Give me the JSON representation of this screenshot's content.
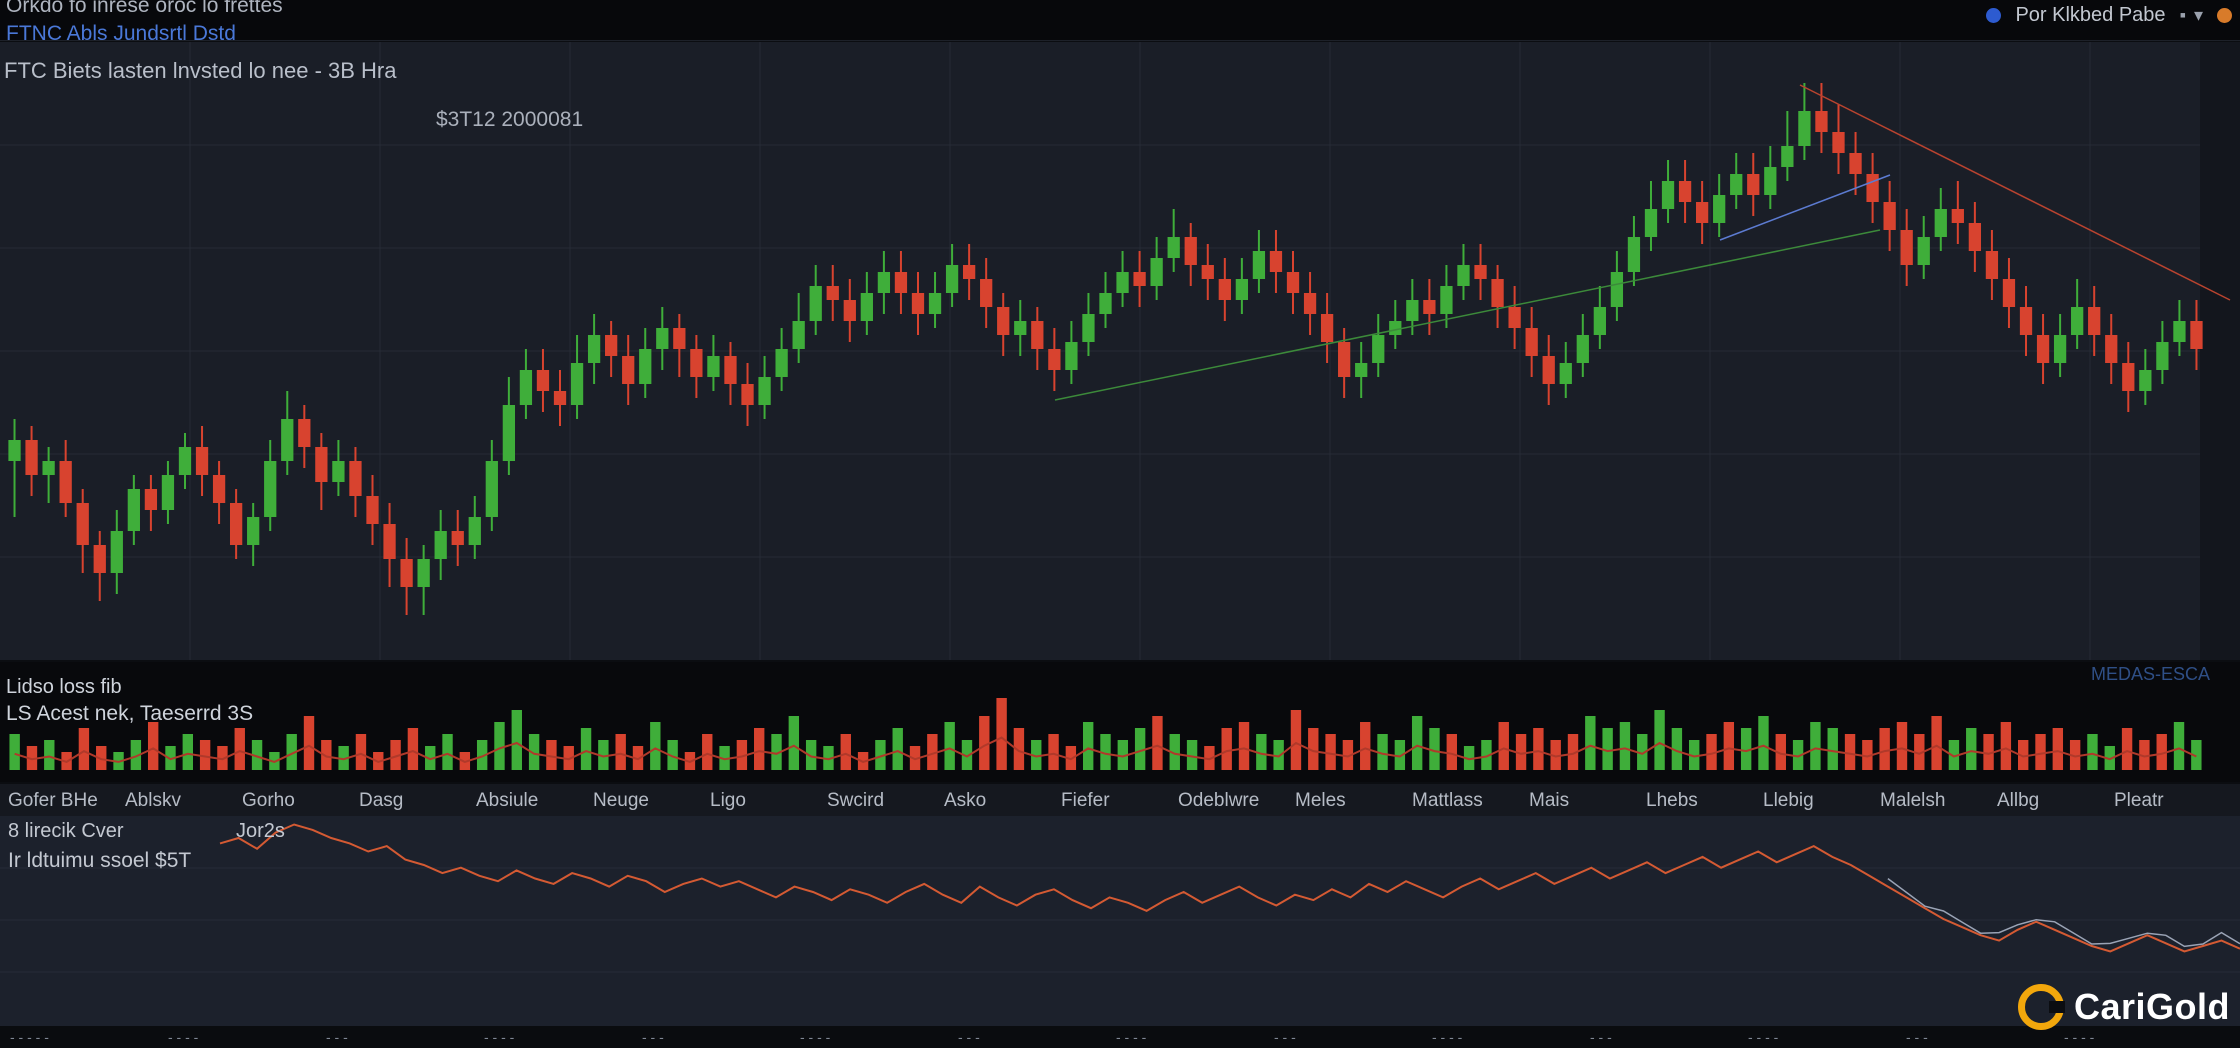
{
  "window": {
    "title": "Orkdo fo inrese oroc lo frettes",
    "subtitle": "FTNC Abls  Jundsrtl Dstd",
    "right_label": "Por Klkbed Pabe",
    "right_tools": [
      "▪",
      "▾"
    ]
  },
  "main_panel": {
    "pair_line": "FTC Biets lasten lnvsted lo nee - 3B Hra",
    "price_readout": "$3T12 2000081"
  },
  "volume_panel": {
    "title": "Lidso loss fib",
    "subtitle": "LS Acest nek, Taeserrd 3S",
    "right_label": "MEDAS-ESCA"
  },
  "x_axis_labels": [
    "Gofer BHe",
    "Ablskv",
    "Gorho",
    "Dasg",
    "Absiule",
    "Neuge",
    "Ligo",
    "Swcird",
    "Asko",
    "Fiefer",
    "Odeblwre",
    "Meles",
    "Mattlass",
    "Mais",
    "Lhebs",
    "Llebig",
    "Malelsh",
    "Allbg",
    "Pleatr"
  ],
  "oscillator_panel": {
    "title": "8 lirecik Cver",
    "subtitle": "Ir ldtuimu ssoel $5T",
    "value": "Jor2s"
  },
  "brand": {
    "name": "CariGold",
    "color": "#f2a70c"
  },
  "bottom_axis": [
    "- - - - -",
    "- - - -",
    "- - -",
    "- - - -",
    "- - -",
    "- - - -",
    "- - -",
    "- - - -",
    "- - -",
    "- - - -",
    "- - -",
    "- - - -",
    "- - -",
    "- - - -"
  ],
  "colors": {
    "up": "#3fae3a",
    "down": "#d8432f",
    "background": "#1b1f28",
    "grid": "#262b36",
    "osc_line": "#d45a33"
  },
  "chart_data": {
    "type": "candlestick",
    "title": "FTC Biets lasten lnvsted lo nee - 3B Hra",
    "candles": [
      [
        52,
        55,
        44,
        58
      ],
      [
        55,
        50,
        47,
        57
      ],
      [
        50,
        52,
        46,
        54
      ],
      [
        52,
        46,
        44,
        55
      ],
      [
        46,
        40,
        36,
        48
      ],
      [
        40,
        36,
        32,
        42
      ],
      [
        36,
        42,
        33,
        45
      ],
      [
        42,
        48,
        40,
        50
      ],
      [
        48,
        45,
        42,
        50
      ],
      [
        45,
        50,
        43,
        52
      ],
      [
        50,
        54,
        48,
        56
      ],
      [
        54,
        50,
        47,
        57
      ],
      [
        50,
        46,
        43,
        52
      ],
      [
        46,
        40,
        38,
        48
      ],
      [
        40,
        44,
        37,
        46
      ],
      [
        44,
        52,
        42,
        55
      ],
      [
        52,
        58,
        50,
        62
      ],
      [
        58,
        54,
        51,
        60
      ],
      [
        54,
        49,
        45,
        56
      ],
      [
        49,
        52,
        47,
        55
      ],
      [
        52,
        47,
        44,
        54
      ],
      [
        47,
        43,
        40,
        50
      ],
      [
        43,
        38,
        34,
        46
      ],
      [
        38,
        34,
        30,
        41
      ],
      [
        34,
        38,
        30,
        40
      ],
      [
        38,
        42,
        35,
        45
      ],
      [
        42,
        40,
        37,
        45
      ],
      [
        40,
        44,
        38,
        47
      ],
      [
        44,
        52,
        42,
        55
      ],
      [
        52,
        60,
        50,
        64
      ],
      [
        60,
        65,
        58,
        68
      ],
      [
        65,
        62,
        59,
        68
      ],
      [
        62,
        60,
        57,
        65
      ],
      [
        60,
        66,
        58,
        70
      ],
      [
        66,
        70,
        63,
        73
      ],
      [
        70,
        67,
        64,
        72
      ],
      [
        67,
        63,
        60,
        70
      ],
      [
        63,
        68,
        61,
        71
      ],
      [
        68,
        71,
        65,
        74
      ],
      [
        71,
        68,
        64,
        73
      ],
      [
        68,
        64,
        61,
        70
      ],
      [
        64,
        67,
        62,
        70
      ],
      [
        67,
        63,
        60,
        69
      ],
      [
        63,
        60,
        57,
        66
      ],
      [
        60,
        64,
        58,
        67
      ],
      [
        64,
        68,
        62,
        71
      ],
      [
        68,
        72,
        66,
        76
      ],
      [
        72,
        77,
        70,
        80
      ],
      [
        77,
        75,
        72,
        80
      ],
      [
        75,
        72,
        69,
        78
      ],
      [
        72,
        76,
        70,
        79
      ],
      [
        76,
        79,
        73,
        82
      ],
      [
        79,
        76,
        73,
        82
      ],
      [
        76,
        73,
        70,
        79
      ],
      [
        73,
        76,
        71,
        79
      ],
      [
        76,
        80,
        74,
        83
      ],
      [
        80,
        78,
        75,
        83
      ],
      [
        78,
        74,
        71,
        81
      ],
      [
        74,
        70,
        67,
        76
      ],
      [
        70,
        72,
        67,
        75
      ],
      [
        72,
        68,
        65,
        74
      ],
      [
        68,
        65,
        62,
        71
      ],
      [
        65,
        69,
        63,
        72
      ],
      [
        69,
        73,
        67,
        76
      ],
      [
        73,
        76,
        71,
        79
      ],
      [
        76,
        79,
        74,
        82
      ],
      [
        79,
        77,
        74,
        82
      ],
      [
        77,
        81,
        75,
        84
      ],
      [
        81,
        84,
        79,
        88
      ],
      [
        84,
        80,
        77,
        86
      ],
      [
        80,
        78,
        75,
        83
      ],
      [
        78,
        75,
        72,
        81
      ],
      [
        75,
        78,
        73,
        81
      ],
      [
        78,
        82,
        76,
        85
      ],
      [
        82,
        79,
        76,
        85
      ],
      [
        79,
        76,
        73,
        82
      ],
      [
        76,
        73,
        70,
        79
      ],
      [
        73,
        69,
        66,
        76
      ],
      [
        69,
        64,
        61,
        71
      ],
      [
        64,
        66,
        61,
        69
      ],
      [
        66,
        70,
        64,
        73
      ],
      [
        70,
        72,
        68,
        75
      ],
      [
        72,
        75,
        70,
        78
      ],
      [
        75,
        73,
        70,
        78
      ],
      [
        73,
        77,
        71,
        80
      ],
      [
        77,
        80,
        75,
        83
      ],
      [
        80,
        78,
        75,
        83
      ],
      [
        78,
        74,
        71,
        80
      ],
      [
        74,
        71,
        68,
        77
      ],
      [
        71,
        67,
        64,
        74
      ],
      [
        67,
        63,
        60,
        70
      ],
      [
        63,
        66,
        61,
        69
      ],
      [
        66,
        70,
        64,
        73
      ],
      [
        70,
        74,
        68,
        77
      ],
      [
        74,
        79,
        72,
        82
      ],
      [
        79,
        84,
        77,
        87
      ],
      [
        84,
        88,
        82,
        92
      ],
      [
        88,
        92,
        86,
        95
      ],
      [
        92,
        89,
        86,
        95
      ],
      [
        89,
        86,
        83,
        92
      ],
      [
        86,
        90,
        84,
        93
      ],
      [
        90,
        93,
        88,
        96
      ],
      [
        93,
        90,
        87,
        96
      ],
      [
        90,
        94,
        88,
        97
      ],
      [
        94,
        97,
        92,
        102
      ],
      [
        97,
        102,
        95,
        106
      ],
      [
        102,
        99,
        96,
        106
      ],
      [
        99,
        96,
        93,
        103
      ],
      [
        96,
        93,
        90,
        99
      ],
      [
        93,
        89,
        86,
        96
      ],
      [
        89,
        85,
        82,
        92
      ],
      [
        85,
        80,
        77,
        88
      ],
      [
        80,
        84,
        78,
        87
      ],
      [
        84,
        88,
        82,
        91
      ],
      [
        88,
        86,
        83,
        92
      ],
      [
        86,
        82,
        79,
        89
      ],
      [
        82,
        78,
        75,
        85
      ],
      [
        78,
        74,
        71,
        81
      ],
      [
        74,
        70,
        67,
        77
      ],
      [
        70,
        66,
        63,
        73
      ],
      [
        66,
        70,
        64,
        73
      ],
      [
        70,
        74,
        68,
        78
      ],
      [
        74,
        70,
        67,
        77
      ],
      [
        70,
        66,
        63,
        73
      ],
      [
        66,
        62,
        59,
        69
      ],
      [
        62,
        65,
        60,
        68
      ],
      [
        65,
        69,
        63,
        72
      ],
      [
        69,
        72,
        67,
        75
      ],
      [
        72,
        68,
        65,
        75
      ]
    ],
    "volume": [
      6,
      4,
      5,
      3,
      7,
      4,
      3,
      5,
      8,
      4,
      6,
      5,
      4,
      7,
      5,
      3,
      6,
      9,
      5,
      4,
      6,
      3,
      5,
      7,
      4,
      6,
      3,
      5,
      8,
      10,
      6,
      5,
      4,
      7,
      5,
      6,
      4,
      8,
      5,
      3,
      6,
      4,
      5,
      7,
      6,
      9,
      5,
      4,
      6,
      3,
      5,
      7,
      4,
      6,
      8,
      5,
      9,
      12,
      7,
      5,
      6,
      4,
      8,
      6,
      5,
      7,
      9,
      6,
      5,
      4,
      7,
      8,
      6,
      5,
      10,
      7,
      6,
      5,
      8,
      6,
      5,
      9,
      7,
      6,
      4,
      5,
      8,
      6,
      7,
      5,
      6,
      9,
      7,
      8,
      6,
      10,
      7,
      5,
      6,
      8,
      7,
      9,
      6,
      5,
      8,
      7,
      6,
      5,
      7,
      8,
      6,
      9,
      5,
      7,
      6,
      8,
      5,
      6,
      7,
      5,
      6,
      4,
      7,
      5,
      6,
      8,
      5
    ],
    "oscillator": [
      58,
      60,
      56,
      62,
      65,
      63,
      60,
      58,
      55,
      57,
      52,
      50,
      47,
      49,
      46,
      44,
      48,
      45,
      43,
      47,
      45,
      42,
      46,
      44,
      40,
      43,
      45,
      42,
      44,
      41,
      38,
      42,
      40,
      37,
      41,
      39,
      36,
      40,
      43,
      39,
      36,
      42,
      38,
      35,
      39,
      41,
      37,
      34,
      38,
      36,
      33,
      37,
      40,
      36,
      39,
      42,
      38,
      35,
      39,
      37,
      41,
      38,
      43,
      40,
      44,
      41,
      38,
      42,
      45,
      41,
      44,
      47,
      43,
      46,
      49,
      45,
      48,
      51,
      47,
      50,
      53,
      49,
      52,
      55,
      51,
      54,
      57,
      53,
      50,
      46,
      42,
      38,
      34,
      30,
      27,
      24,
      22,
      26,
      29,
      26,
      23,
      20,
      18,
      21,
      24,
      21,
      18,
      20,
      22,
      19
    ]
  }
}
